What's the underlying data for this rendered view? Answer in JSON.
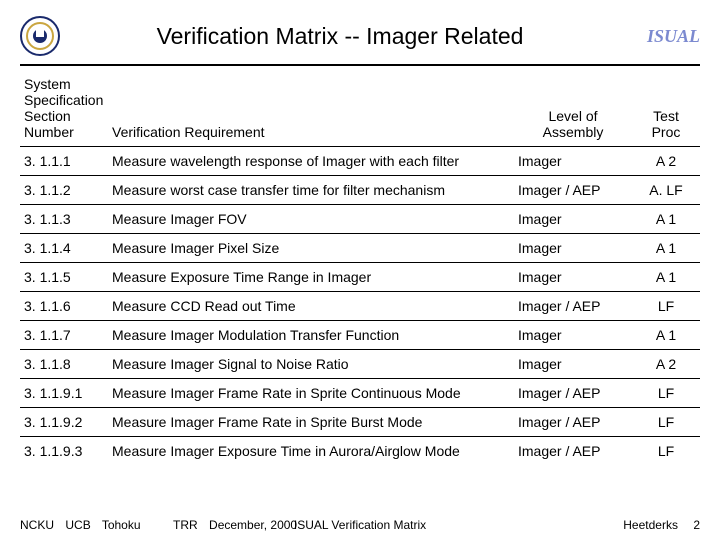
{
  "header": {
    "title": "Verification Matrix -- Imager Related",
    "logo": "ISUAL"
  },
  "table": {
    "headers": {
      "section": "System\nSpecification\nSection\nNumber",
      "requirement": "Verification Requirement",
      "level": "Level of\nAssembly",
      "proc": "Test\nProc"
    },
    "rows": [
      {
        "section": "3. 1.1.1",
        "req": "Measure wavelength response of Imager with each filter",
        "level": "Imager",
        "proc": "A 2"
      },
      {
        "section": "3. 1.1.2",
        "req": "Measure worst case transfer time for filter mechanism",
        "level": "Imager / AEP",
        "proc": "A. LF"
      },
      {
        "section": "3. 1.1.3",
        "req": "Measure Imager FOV",
        "level": "Imager",
        "proc": "A 1"
      },
      {
        "section": "3. 1.1.4",
        "req": "Measure Imager Pixel Size",
        "level": "Imager",
        "proc": "A 1"
      },
      {
        "section": "3. 1.1.5",
        "req": "Measure Exposure Time Range in Imager",
        "level": "Imager",
        "proc": "A 1"
      },
      {
        "section": "3. 1.1.6",
        "req": "Measure CCD Read out Time",
        "level": "Imager / AEP",
        "proc": "LF"
      },
      {
        "section": "3. 1.1.7",
        "req": "Measure Imager Modulation Transfer Function",
        "level": "Imager",
        "proc": "A 1"
      },
      {
        "section": "3. 1.1.8",
        "req": "Measure Imager Signal to Noise Ratio",
        "level": "Imager",
        "proc": "A 2"
      },
      {
        "section": "3. 1.1.9.1",
        "req": "Measure Imager Frame Rate in Sprite Continuous Mode",
        "level": "Imager / AEP",
        "proc": "LF"
      },
      {
        "section": "3. 1.1.9.2",
        "req": "Measure Imager Frame Rate in Sprite Burst Mode",
        "level": "Imager / AEP",
        "proc": "LF"
      },
      {
        "section": "3. 1.1.9.3",
        "req": "Measure Imager Exposure Time in Aurora/Airglow Mode",
        "level": "Imager / AEP",
        "proc": "LF"
      }
    ]
  },
  "footer": {
    "org1": "NCKU",
    "org2": "UCB",
    "org3": "Tohoku",
    "event": "TRR",
    "date": "December, 2000",
    "center": "ISUAL Verification Matrix",
    "author": "Heetderks",
    "page": "2"
  }
}
